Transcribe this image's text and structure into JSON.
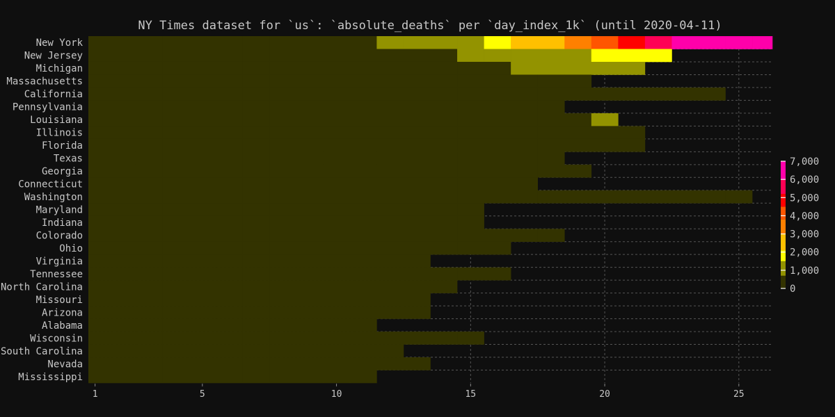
{
  "chart_data": {
    "type": "heatmap",
    "title": "NY Times dataset for `us`: `absolute_deaths` per `day_index_1k` (until 2020-04-11)",
    "xlabel": "",
    "ylabel": "",
    "x_ticks": [
      1,
      5,
      10,
      15,
      20,
      25
    ],
    "xlim": [
      0.75,
      26.25
    ],
    "x": [
      1,
      2,
      3,
      4,
      5,
      6,
      7,
      8,
      9,
      10,
      11,
      12,
      13,
      14,
      15,
      16,
      17,
      18,
      19,
      20,
      21,
      22,
      23,
      24,
      25,
      26
    ],
    "grid": true,
    "colorbar": {
      "position": "right",
      "range": [
        0,
        7000
      ],
      "ticks": [
        "0",
        "1,000",
        "2,000",
        "3,000",
        "4,000",
        "5,000",
        "6,000",
        "7,000"
      ],
      "bins": [
        {
          "max": 700,
          "color": "#333300"
        },
        {
          "max": 1500,
          "color": "#939300"
        },
        {
          "max": 2100,
          "color": "#ffff00"
        },
        {
          "max": 3000,
          "color": "#ffc000"
        },
        {
          "max": 3800,
          "color": "#ff8000"
        },
        {
          "max": 4500,
          "color": "#ff5500"
        },
        {
          "max": 5200,
          "color": "#ff0000"
        },
        {
          "max": 6000,
          "color": "#ff0055"
        },
        {
          "max": 99999,
          "color": "#ff00aa"
        }
      ]
    },
    "colors": {
      "background": "#0f0f0f",
      "missing": "#0f0f0f",
      "grid": "#555555",
      "text": "#c8c8c8"
    },
    "series": [
      {
        "name": "New York",
        "values": [
          1,
          1,
          2,
          3,
          5,
          10,
          17,
          30,
          60,
          100,
          200,
          1000,
          1100,
          1250,
          1400,
          1700,
          2300,
          2700,
          3300,
          4000,
          4700,
          5500,
          6200,
          6500,
          6800,
          7000
        ]
      },
      {
        "name": "New Jersey",
        "values": [
          0,
          1,
          1,
          2,
          3,
          5,
          9,
          16,
          27,
          44,
          62,
          81,
          108,
          140,
          800,
          950,
          1100,
          1250,
          1400,
          1700,
          1900,
          2050
        ]
      },
      {
        "name": "Michigan",
        "values": [
          0,
          1,
          1,
          2,
          3,
          5,
          8,
          15,
          24,
          43,
          60,
          92,
          111,
          132,
          184,
          260,
          750,
          850,
          950,
          1100,
          1250
        ]
      },
      {
        "name": "Massachusetts",
        "values": [
          0,
          1,
          1,
          2,
          3,
          5,
          8,
          11,
          15,
          25,
          35,
          44,
          56,
          89,
          122,
          154,
          192,
          216,
          231
        ]
      },
      {
        "name": "California",
        "values": [
          1,
          1,
          2,
          4,
          5,
          11,
          16,
          24,
          28,
          35,
          40,
          50,
          65,
          78,
          86,
          101,
          132,
          173,
          199,
          246,
          282,
          339,
          374,
          433
        ]
      },
      {
        "name": "Pennsylvania",
        "values": [
          1,
          1,
          2,
          4,
          7,
          10,
          16,
          22,
          34,
          38,
          63,
          74,
          90,
          136,
          150,
          240,
          300,
          416
        ]
      },
      {
        "name": "Louisiana",
        "values": [
          1,
          2,
          4,
          7,
          10,
          17,
          18,
          20,
          35,
          46,
          65,
          86,
          119,
          151,
          185,
          239,
          273,
          310,
          370,
          750
        ]
      },
      {
        "name": "Illinois",
        "values": [
          1,
          1,
          4,
          4,
          5,
          9,
          12,
          16,
          19,
          26,
          34,
          47,
          66,
          73,
          99,
          141,
          157,
          210,
          243,
          274,
          307
        ]
      },
      {
        "name": "Florida",
        "values": [
          2,
          2,
          3,
          5,
          7,
          9,
          10,
          13,
          18,
          22,
          25,
          33,
          52,
          68,
          85,
          100,
          131,
          170,
          200,
          240,
          280
        ]
      },
      {
        "name": "Texas",
        "values": [
          1,
          1,
          2,
          4,
          5,
          6,
          9,
          11,
          16,
          24,
          27,
          35,
          45,
          58,
          78,
          91,
          110,
          130
        ]
      },
      {
        "name": "Georgia",
        "values": [
          1,
          1,
          3,
          4,
          10,
          14,
          20,
          25,
          32,
          40,
          48,
          56,
          68,
          80,
          102,
          125,
          150,
          180,
          208
        ]
      },
      {
        "name": "Connecticut",
        "values": [
          1,
          1,
          3,
          4,
          5,
          6,
          8,
          12,
          19,
          21,
          27,
          33,
          36,
          69,
          85,
          112,
          131
        ]
      },
      {
        "name": "Washington",
        "values": [
          1,
          6,
          9,
          11,
          12,
          16,
          19,
          22,
          24,
          30,
          32,
          37,
          40,
          50,
          66,
          83,
          94,
          110,
          125,
          132,
          147,
          175,
          189,
          200,
          220
        ]
      },
      {
        "name": "Maryland",
        "values": [
          1,
          1,
          2,
          3,
          3,
          4,
          5,
          5,
          10,
          15,
          18,
          21,
          31,
          36,
          54
        ]
      },
      {
        "name": "Indiana",
        "values": [
          1,
          2,
          2,
          3,
          4,
          7,
          12,
          14,
          17,
          25,
          32,
          49,
          65,
          78,
          102
        ]
      },
      {
        "name": "Colorado",
        "values": [
          1,
          2,
          4,
          5,
          7,
          11,
          19,
          24,
          31,
          44,
          47,
          51,
          69,
          80,
          97,
          111,
          126,
          140
        ]
      },
      {
        "name": "Ohio",
        "values": [
          1,
          2,
          3,
          3,
          6,
          8,
          10,
          15,
          19,
          25,
          29,
          39,
          55,
          65,
          81,
          91
        ]
      },
      {
        "name": "Virginia",
        "values": [
          1,
          2,
          2,
          3,
          5,
          7,
          9,
          14,
          17,
          22,
          27,
          34,
          41
        ]
      },
      {
        "name": "Tennessee",
        "values": [
          1,
          1,
          2,
          3,
          5,
          6,
          8,
          13,
          23,
          24,
          32,
          37,
          43,
          53,
          65,
          73
        ]
      },
      {
        "name": "North Carolina",
        "values": [
          1,
          2,
          4,
          4,
          4,
          8,
          9,
          11,
          16,
          22,
          27,
          33,
          45,
          53
        ]
      },
      {
        "name": "Missouri",
        "values": [
          1,
          3,
          4,
          5,
          8,
          9,
          12,
          17,
          26,
          30,
          36,
          49,
          59
        ]
      },
      {
        "name": "Arizona",
        "values": [
          1,
          2,
          3,
          5,
          6,
          8,
          15,
          16,
          18,
          19,
          24,
          33,
          40
        ]
      },
      {
        "name": "Alabama",
        "values": [
          1,
          2,
          3,
          5,
          6,
          9,
          12,
          19,
          26,
          32,
          43
        ]
      },
      {
        "name": "Wisconsin",
        "values": [
          1,
          3,
          4,
          6,
          8,
          11,
          15,
          19,
          25,
          34,
          45,
          55,
          60,
          71,
          81
        ]
      },
      {
        "name": "South Carolina",
        "values": [
          1,
          1,
          3,
          5,
          5,
          5,
          9,
          11,
          13,
          16,
          21,
          22
        ]
      },
      {
        "name": "Nevada",
        "values": [
          1,
          2,
          4,
          6,
          9,
          12,
          15,
          20,
          24,
          28,
          34,
          47,
          53
        ]
      },
      {
        "name": "Mississippi",
        "values": [
          1,
          1,
          2,
          4,
          6,
          8,
          13,
          15,
          22,
          29,
          33
        ]
      }
    ]
  }
}
